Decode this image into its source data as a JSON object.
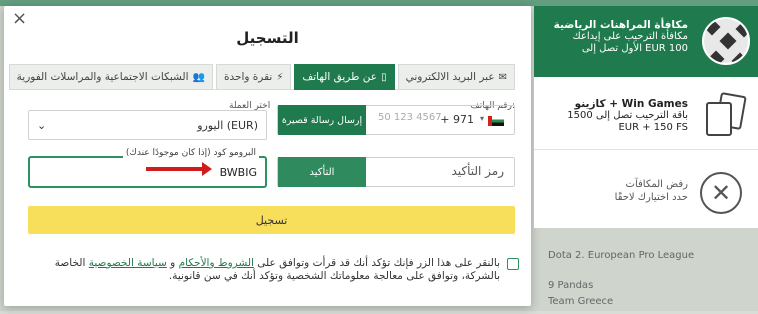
{
  "modal": {
    "close_glyph": "×",
    "title": "التسجيل",
    "tabs": [
      {
        "label": "عبر البريد الالكتروني",
        "icon": "email-icon",
        "active": false
      },
      {
        "label": "عن طريق الهاتف",
        "icon": "phone-icon",
        "active": true
      },
      {
        "label": "نقرة واحدة",
        "icon": "lightning-icon",
        "active": false
      },
      {
        "label": "الشبكات الاجتماعية والمراسلات الفورية",
        "icon": "users-icon",
        "active": false
      }
    ],
    "phone": {
      "label": "رقم الهاتف:",
      "code": "+ 971",
      "placeholder": "50 123 4567",
      "sms_button": "إرسال رسالة قصيرة"
    },
    "currency": {
      "label": "اختر العملة",
      "value": "اليورو (EUR)"
    },
    "confirmation": {
      "placeholder": "رمز التأكيد",
      "button": "التأكيد"
    },
    "promo": {
      "label": "البرومو كود (إذا كان موجودًا عندك)",
      "value": "BWBIG"
    },
    "register_button": "تسجيل",
    "terms": {
      "prefix": "بالنقر على هذا الزر فإنك تؤكد أنك قد قرأت وتوافق على",
      "link1": "الشروط والأحكام",
      "and": "و",
      "link2": "سياسة الخصوصية",
      "suffix": "الخاصة بالشركة، وتوافق على معالجة معلوماتك الشخصية وتؤكد أنك في سن قانونية."
    }
  },
  "bonuses": {
    "sport": {
      "title": "مكافأة المراهنات الرياضية",
      "line1": "مكافأة الترحيب على إيداعك",
      "line2": "الأول تصل إلى EUR 100"
    },
    "casino": {
      "title": "كازينو + Win Games",
      "line1": "باقة الترحيب تصل إلى 1500",
      "line2": "EUR + 150 FS"
    },
    "decline": {
      "title": "رفض المكافآت",
      "subtitle": "حدد اختيارك لاحقًا"
    }
  },
  "background": {
    "row1": "Dota 2. European Pro League",
    "row2": "9 Pandas",
    "row3": "Team Greece"
  },
  "colors": {
    "brand_green": "#1f7a4e",
    "register_yellow": "#f7df5c",
    "arrow_red": "#d01c1c"
  }
}
